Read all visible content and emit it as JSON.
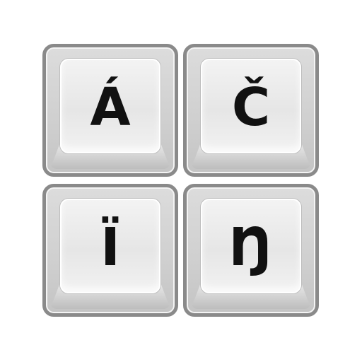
{
  "keys": [
    {
      "char": "Á"
    },
    {
      "char": "Č"
    },
    {
      "char": "Ï"
    },
    {
      "char": "Ŋ"
    }
  ]
}
